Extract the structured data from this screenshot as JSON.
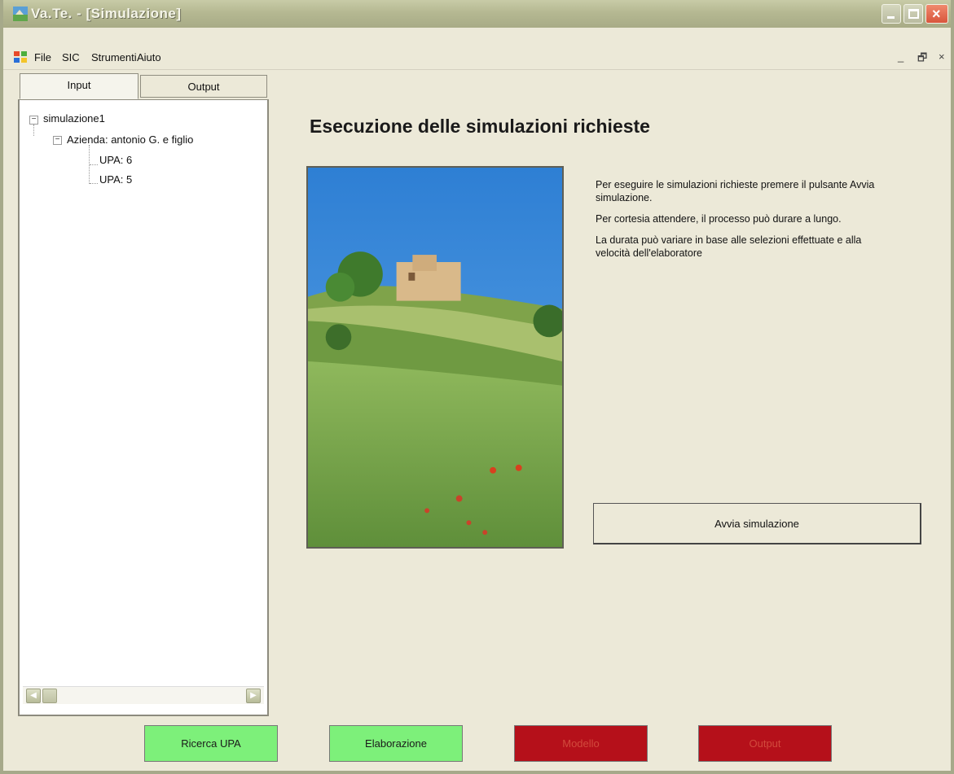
{
  "window": {
    "title": "Va.Te. - [Simulazione]"
  },
  "menu": {
    "items": [
      "File",
      "SIC",
      "Strumenti",
      "Aiuto"
    ],
    "mdi_min": "_",
    "mdi_restore": "🗗",
    "mdi_close": "×"
  },
  "left_panel": {
    "tabs": [
      "Input",
      "Output"
    ],
    "active_tab": "Input",
    "tree": {
      "root": "simulazione1",
      "azienda": "Azienda: antonio G. e figlio",
      "upa": [
        "UPA: 6",
        "UPA: 5"
      ]
    }
  },
  "main": {
    "title": "Esecuzione delle simulazioni richieste",
    "paragraphs": [
      "Per eseguire le simulazioni richieste premere il pulsante Avvia simulazione.",
      "Per cortesia attendere, il processo può durare a lungo.",
      "La durata può variare in base alle selezioni effettuate e alla velocità dell'elaboratore"
    ],
    "run_button": "Avvia simulazione"
  },
  "bottom_buttons": {
    "ricerca": "Ricerca UPA",
    "elaborazione": "Elaborazione",
    "modello": "Modello",
    "output": "Output"
  },
  "colors": {
    "green_button": "#7df07a",
    "red_button": "#b5101a",
    "background": "#ece9d8"
  },
  "icons": {
    "app": "landscape-app-icon",
    "menu": "windows-flag-icon"
  }
}
